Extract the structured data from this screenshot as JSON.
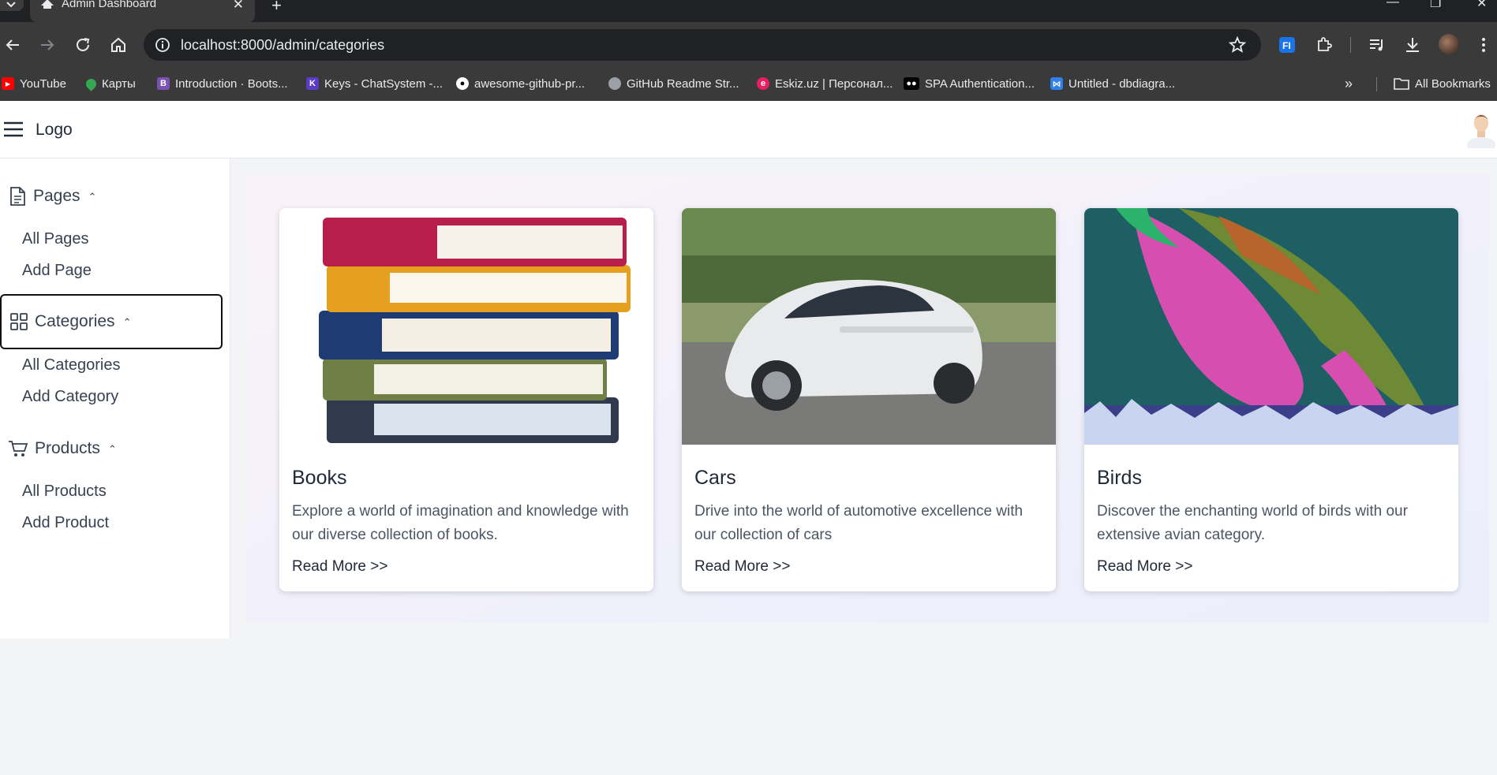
{
  "browser": {
    "tab_title": "Admin Dashboard",
    "url": "localhost:8000/admin/categories",
    "bookmarks": [
      {
        "label": "YouTube",
        "icon": "youtube-icon",
        "color": "#ff0000"
      },
      {
        "label": "Карты",
        "icon": "maps-icon",
        "color": "#34a853"
      },
      {
        "label": "Introduction · Boots...",
        "icon": "bootstrap-icon",
        "color": "#7952b3"
      },
      {
        "label": "Keys - ChatSystem -...",
        "icon": "keys-icon",
        "color": "#5b3cc4"
      },
      {
        "label": "awesome-github-pr...",
        "icon": "github-icon",
        "color": "#ffffff"
      },
      {
        "label": "GitHub Readme Str...",
        "icon": "globe-icon",
        "color": "#9aa0a6"
      },
      {
        "label": "Eskiz.uz | Персонал...",
        "icon": "eskiz-icon",
        "color": "#e91e63"
      },
      {
        "label": "SPA Authentication...",
        "icon": "medium-icon",
        "color": "#000000"
      },
      {
        "label": "Untitled - dbdiagra...",
        "icon": "dbdiagram-icon",
        "color": "#2f80ed"
      }
    ],
    "all_bookmarks": "All Bookmarks"
  },
  "app": {
    "logo": "Logo",
    "sidebar": {
      "sections": [
        {
          "label": "Pages",
          "icon": "document-icon",
          "items": [
            "All Pages",
            "Add Page"
          ]
        },
        {
          "label": "Categories",
          "icon": "grid-icon",
          "items": [
            "All Categories",
            "Add Category"
          ]
        },
        {
          "label": "Products",
          "icon": "cart-icon",
          "items": [
            "All Products",
            "Add Product"
          ]
        }
      ]
    },
    "cards": [
      {
        "title": "Books",
        "description": "Explore a world of imagination and knowledge with our diverse collection of books.",
        "link": "Read More >>"
      },
      {
        "title": "Cars",
        "description": "Drive into the world of automotive excellence with our collection of cars",
        "link": "Read More >>"
      },
      {
        "title": "Birds",
        "description": "Discover the enchanting world of birds with our extensive avian category.",
        "link": "Read More >>"
      }
    ]
  }
}
